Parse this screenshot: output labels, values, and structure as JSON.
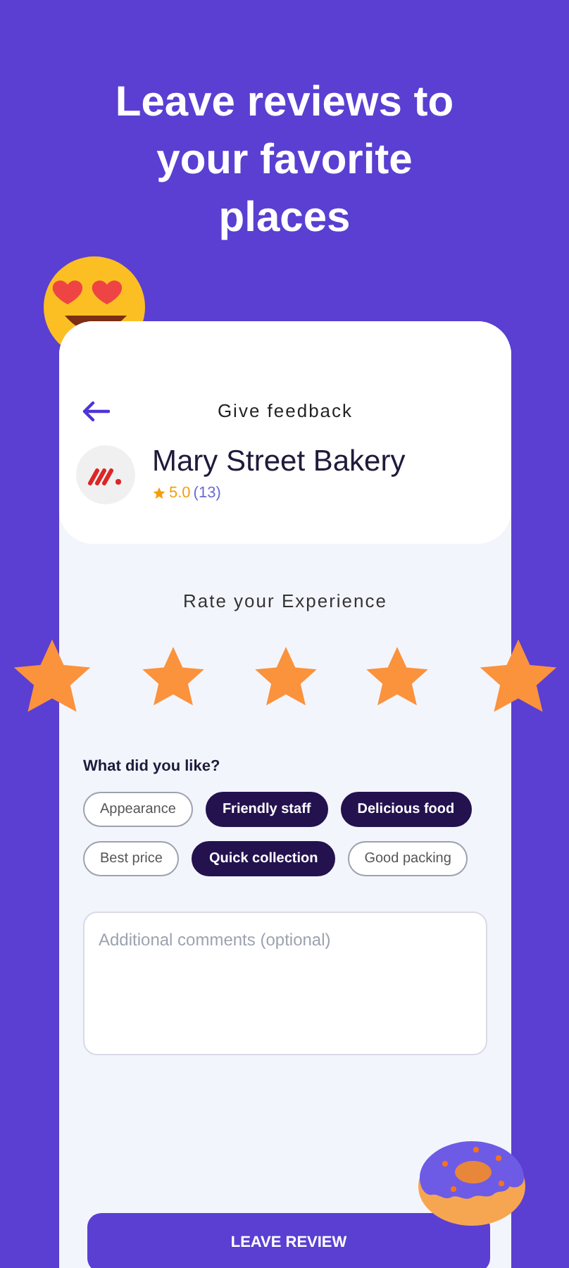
{
  "headline": "Leave reviews to your favorite places",
  "screen": {
    "title": "Give feedback",
    "place": {
      "name": "Mary Street Bakery",
      "rating": "5.0",
      "count": "(13)"
    },
    "rating_prompt": "Rate your Experience",
    "stars": 5,
    "question": "What did you like?",
    "chips": [
      {
        "label": "Appearance",
        "selected": false
      },
      {
        "label": "Friendly staff",
        "selected": true
      },
      {
        "label": "Delicious food",
        "selected": true
      },
      {
        "label": "Best price",
        "selected": false
      },
      {
        "label": "Quick collection",
        "selected": true
      },
      {
        "label": "Good packing",
        "selected": false
      }
    ],
    "comments": {
      "placeholder": "Additional comments (optional)"
    },
    "button": "LEAVE REVIEW"
  }
}
